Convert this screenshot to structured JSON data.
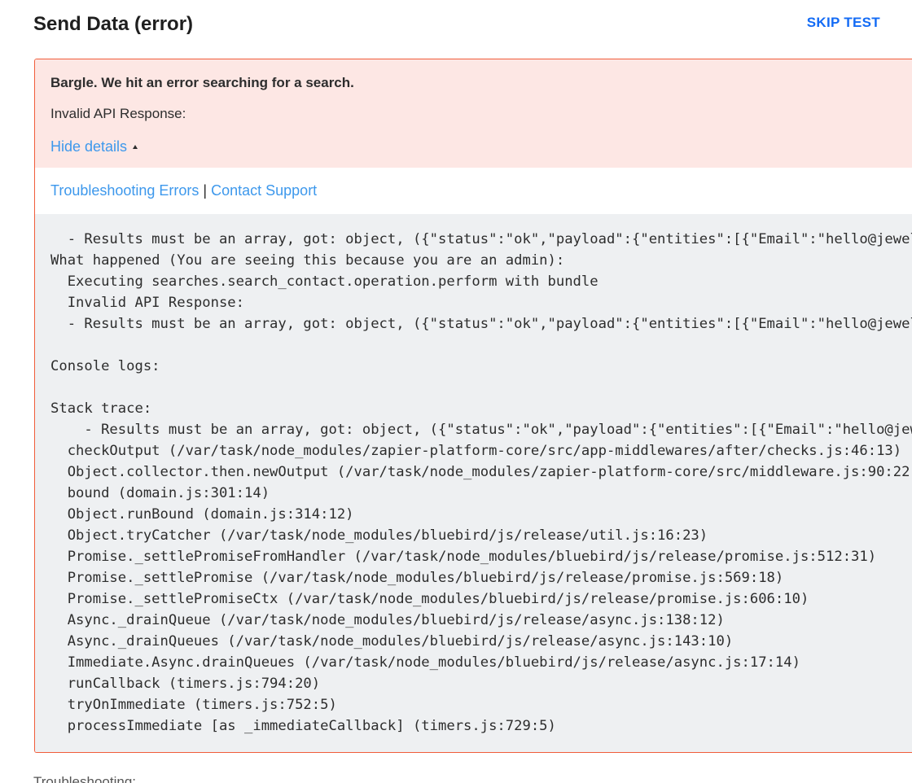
{
  "header": {
    "title": "Send Data (error)",
    "skip_label": "SKIP TEST"
  },
  "error": {
    "title": "Bargle. We hit an error searching for a search.",
    "message": "Invalid API Response:",
    "hide_details_label": "Hide details",
    "links": {
      "troubleshooting": "Troubleshooting Errors",
      "separator": "|",
      "contact": "Contact Support"
    },
    "details_text": "  - Results must be an array, got: object, ({\"status\":\"ok\",\"payload\":{\"entities\":[{\"Email\":\"hello@jewelbox.com\",\nWhat happened (You are seeing this because you are an admin):\n  Executing searches.search_contact.operation.perform with bundle\n  Invalid API Response:\n  - Results must be an array, got: object, ({\"status\":\"ok\",\"payload\":{\"entities\":[{\"Email\":\"hello@jewelbox.com\",\n\nConsole logs:\n\nStack trace:\n    - Results must be an array, got: object, ({\"status\":\"ok\",\"payload\":{\"entities\":[{\"Email\":\"hello@jewelbox.com\",\n  checkOutput (/var/task/node_modules/zapier-platform-core/src/app-middlewares/after/checks.js:46:13)\n  Object.collector.then.newOutput (/var/task/node_modules/zapier-platform-core/src/middleware.js:90:22)\n  bound (domain.js:301:14)\n  Object.runBound (domain.js:314:12)\n  Object.tryCatcher (/var/task/node_modules/bluebird/js/release/util.js:16:23)\n  Promise._settlePromiseFromHandler (/var/task/node_modules/bluebird/js/release/promise.js:512:31)\n  Promise._settlePromise (/var/task/node_modules/bluebird/js/release/promise.js:569:18)\n  Promise._settlePromiseCtx (/var/task/node_modules/bluebird/js/release/promise.js:606:10)\n  Async._drainQueue (/var/task/node_modules/bluebird/js/release/async.js:138:12)\n  Async._drainQueues (/var/task/node_modules/bluebird/js/release/async.js:143:10)\n  Immediate.Async.drainQueues (/var/task/node_modules/bluebird/js/release/async.js:17:14)\n  runCallback (timers.js:794:20)\n  tryOnImmediate (timers.js:752:5)\n  processImmediate [as _immediateCallback] (timers.js:729:5)"
  },
  "footer": {
    "label": "Troubleshooting:"
  },
  "colors": {
    "accent": "#136bf5",
    "link": "#3d98ec",
    "error_border": "#f15d3b",
    "error_background": "#fde7e4",
    "code_background": "#eef0f2"
  }
}
